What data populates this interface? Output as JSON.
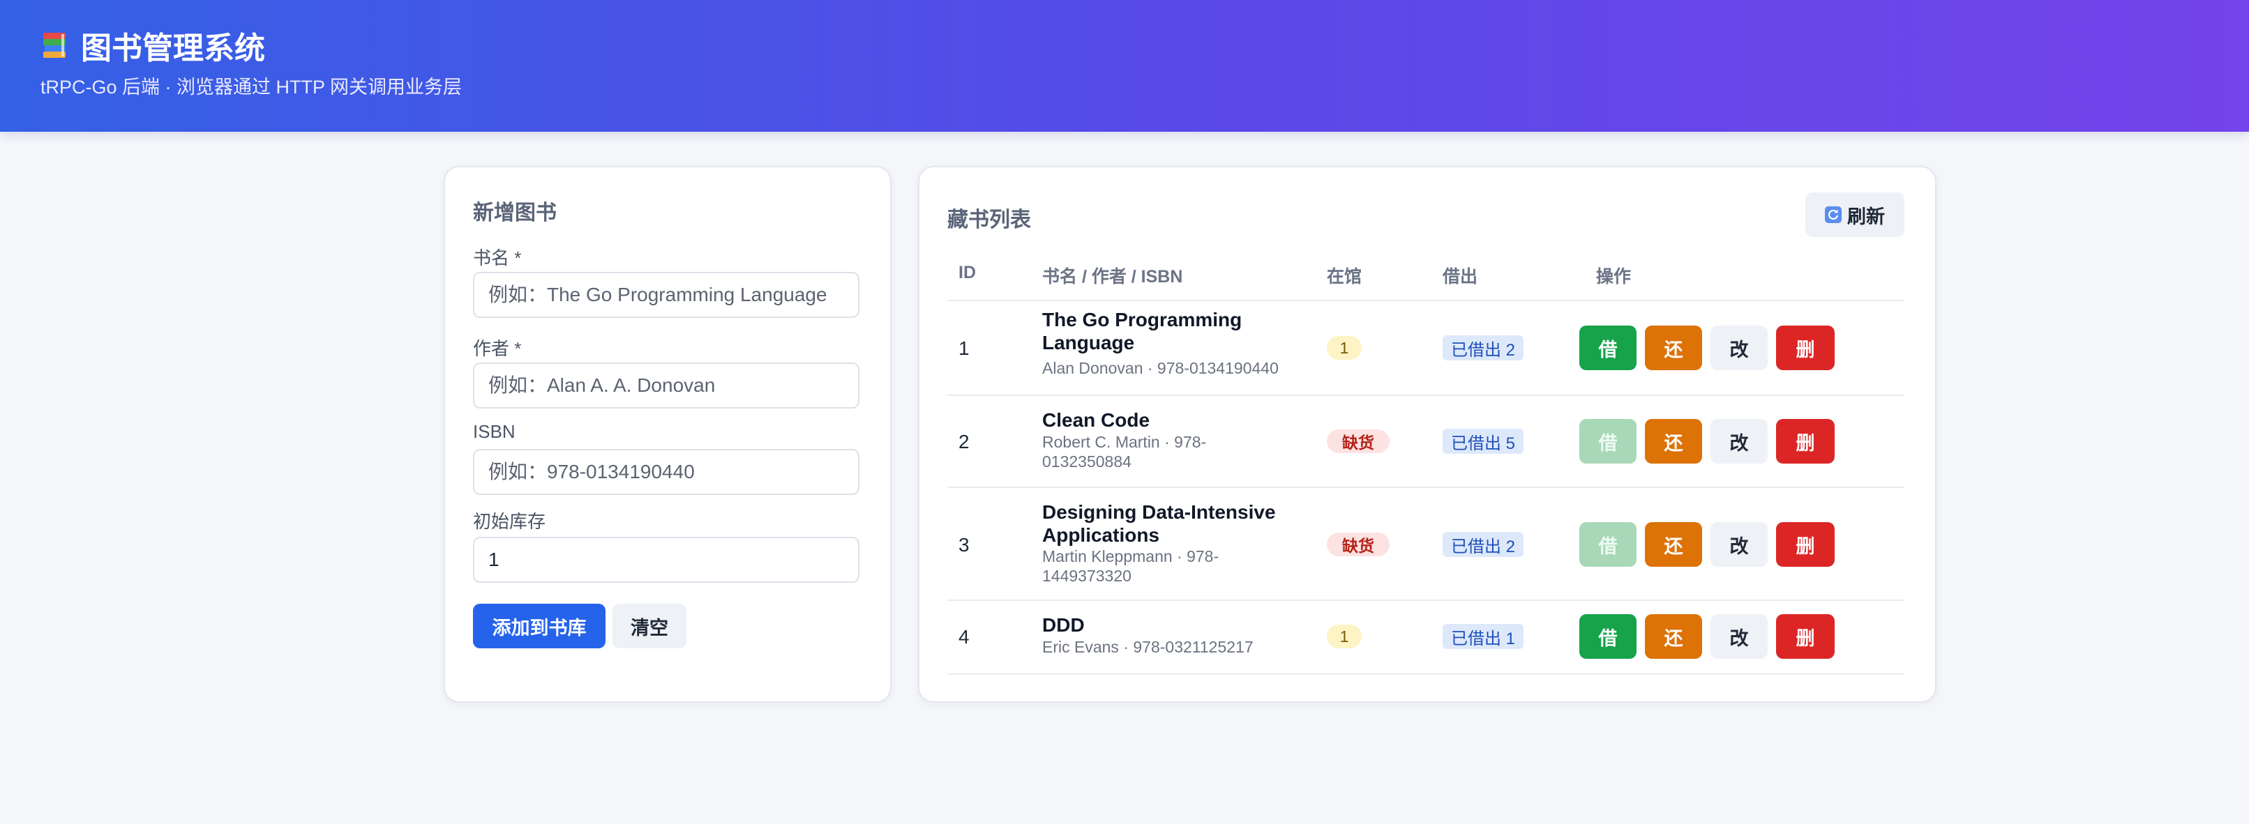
{
  "header": {
    "title": "图书管理系统",
    "subtitle": "tRPC-Go 后端 · 浏览器通过 HTTP 网关调用业务层",
    "icon": "books-icon"
  },
  "form": {
    "title": "新增图书",
    "fields": [
      {
        "label": "书名 *",
        "placeholder": "例如：The Go Programming Language",
        "value": ""
      },
      {
        "label": "作者 *",
        "placeholder": "例如：Alan A. A. Donovan",
        "value": ""
      },
      {
        "label": "ISBN",
        "placeholder": "例如：978-0134190440",
        "value": ""
      },
      {
        "label": "初始库存",
        "placeholder": "",
        "value": "1"
      }
    ],
    "submit_label": "添加到书库",
    "clear_label": "清空"
  },
  "list": {
    "title": "藏书列表",
    "refresh_label": "刷新",
    "columns": [
      "ID",
      "书名 / 作者 / ISBN",
      "在馆",
      "借出",
      "操作"
    ],
    "actions": {
      "borrow": "借",
      "return": "还",
      "edit": "改",
      "delete": "删"
    },
    "rows": [
      {
        "id": "1",
        "title": "The Go Programming Language",
        "meta": "Alan Donovan · 978-0134190440",
        "stock": "1",
        "in_stock": true,
        "borrowed": "已借出 2"
      },
      {
        "id": "2",
        "title": "Clean Code",
        "meta": "Robert C. Martin · 978-0132350884",
        "stock": "缺货",
        "in_stock": false,
        "borrowed": "已借出 5"
      },
      {
        "id": "3",
        "title": "Designing Data-Intensive Applications",
        "meta": "Martin Kleppmann · 978-1449373320",
        "stock": "缺货",
        "in_stock": false,
        "borrowed": "已借出 2"
      },
      {
        "id": "4",
        "title": "DDD",
        "meta": "Eric Evans · 978-0321125217",
        "stock": "1",
        "in_stock": true,
        "borrowed": "已借出 1"
      }
    ]
  },
  "colors": {
    "header_gradient_start": "#3461e6",
    "header_gradient_end": "#7444ec",
    "primary": "#2563eb",
    "borrow": "#16a34a",
    "return": "#dd7206",
    "delete": "#dc2626"
  }
}
